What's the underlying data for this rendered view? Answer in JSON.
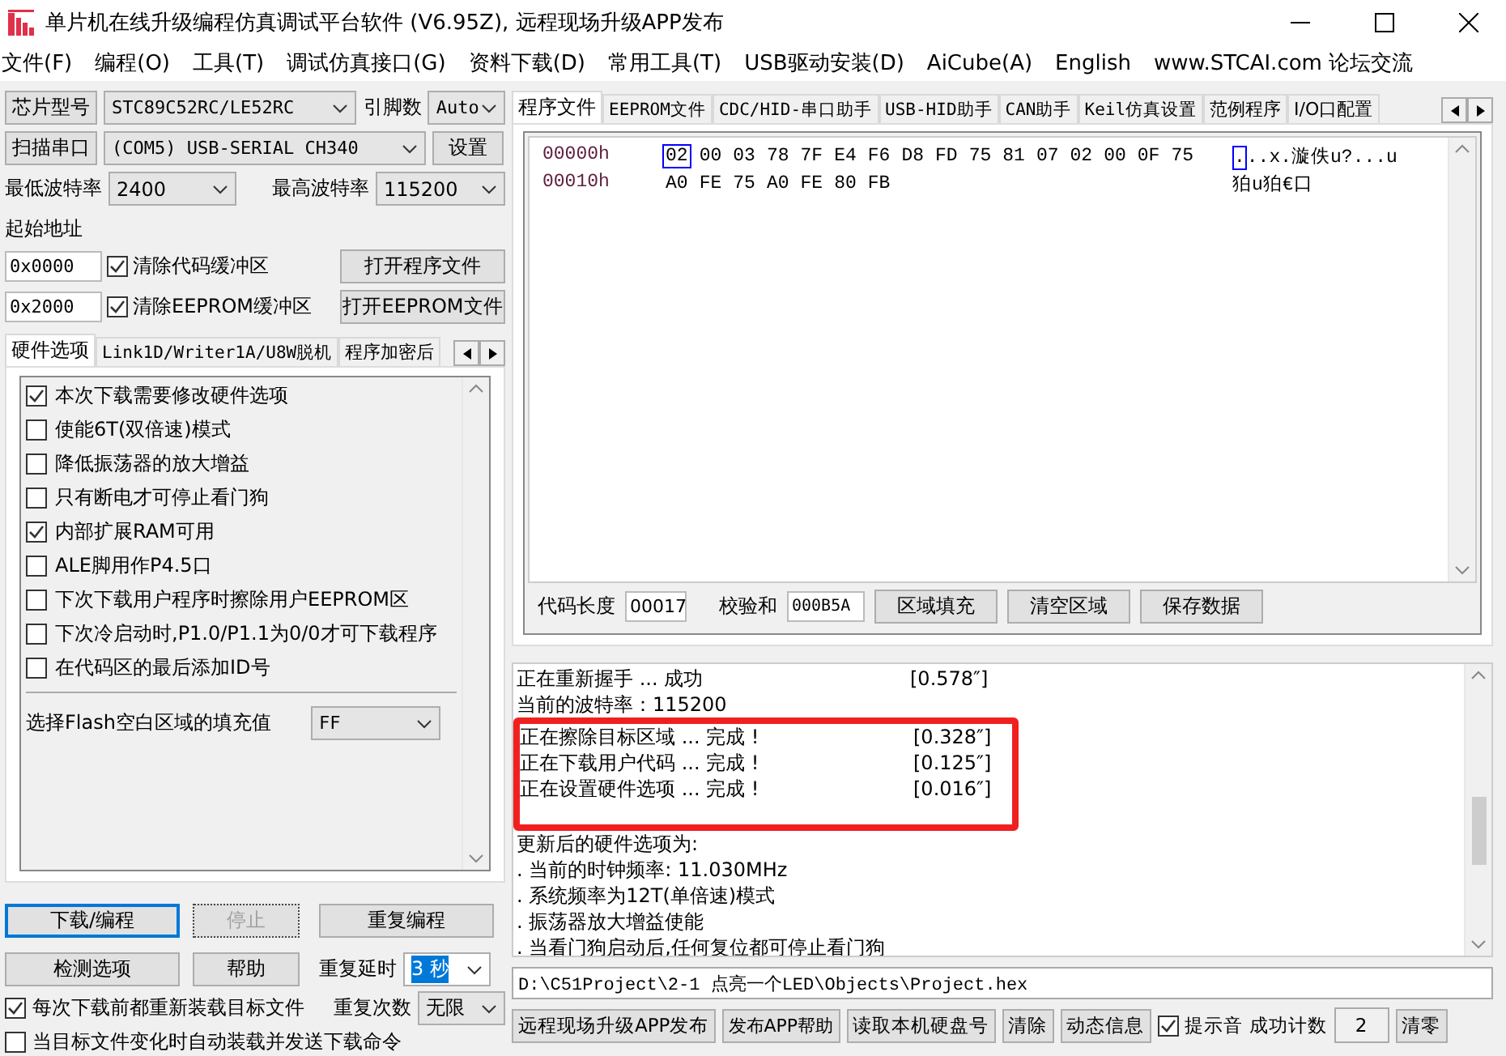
{
  "window": {
    "title": "单片机在线升级编程仿真调试平台软件 (V6.95Z), 远程现场升级APP发布"
  },
  "menu": [
    "文件(F)",
    "编程(O)",
    "工具(T)",
    "调试仿真接口(G)",
    "资料下载(D)",
    "常用工具(T)",
    "USB驱动安装(D)",
    "AiCube(A)",
    "English",
    "www.STCAI.com 论坛交流"
  ],
  "chip": {
    "button": "芯片型号",
    "model": "STC89C52RC/LE52RC",
    "pins_label": "引脚数",
    "pins": "Auto"
  },
  "port": {
    "button": "扫描串口",
    "value": "(COM5) USB-SERIAL CH340",
    "settings": "设置"
  },
  "baud": {
    "min_label": "最低波特率",
    "min": "2400",
    "max_label": "最高波特率",
    "max": "115200"
  },
  "start_address": {
    "label": "起始地址",
    "code_address": "0x0000",
    "clear_code": {
      "label": "清除代码缓冲区",
      "checked": true
    },
    "eeprom_address": "0x2000",
    "clear_eeprom": {
      "label": "清除EEPROM缓冲区",
      "checked": true
    },
    "open_program": "打开程序文件",
    "open_eeprom": "打开EEPROM文件"
  },
  "option_tabs": [
    {
      "label": "硬件选项",
      "selected": true
    },
    {
      "label": "Link1D/Writer1A/U8W脱机",
      "selected": false
    },
    {
      "label": "程序加密后",
      "selected": false
    }
  ],
  "hardware_options": [
    {
      "label": "本次下载需要修改硬件选项",
      "checked": true
    },
    {
      "label": "使能6T(双倍速)模式",
      "checked": false
    },
    {
      "label": "降低振荡器的放大增益",
      "checked": false
    },
    {
      "label": "只有断电才可停止看门狗",
      "checked": false
    },
    {
      "label": "内部扩展RAM可用",
      "checked": true
    },
    {
      "label": "ALE脚用作P4.5口",
      "checked": false
    },
    {
      "label": "下次下载用户程序时擦除用户EEPROM区",
      "checked": false
    },
    {
      "label": "下次冷启动时,P1.0/P1.1为0/0才可下载程序",
      "checked": false
    },
    {
      "label": "在代码区的最后添加ID号",
      "checked": false
    }
  ],
  "fill_value": {
    "label": "选择Flash空白区域的填充值",
    "value": "FF"
  },
  "actions": {
    "download": "下载/编程",
    "stop": {
      "label": "停止",
      "disabled": true
    },
    "repeat": "重复编程",
    "detect": "检测选项",
    "help": "帮助",
    "repeat_delay_label": "重复延时",
    "repeat_delay": "3 秒",
    "repeat_count_label": "重复次数",
    "repeat_count": "无限"
  },
  "reload": {
    "label": "每次下载前都重新装载目标文件",
    "checked": true
  },
  "auto_send": {
    "label": "当目标文件变化时自动装载并发送下载命令",
    "checked": false
  },
  "file_tabs": [
    {
      "label": "程序文件",
      "selected": true
    },
    {
      "label": "EEPROM文件",
      "selected": false
    },
    {
      "label": "CDC/HID-串口助手",
      "selected": false
    },
    {
      "label": "USB-HID助手",
      "selected": false
    },
    {
      "label": "CAN助手",
      "selected": false
    },
    {
      "label": "Keil仿真设置",
      "selected": false
    },
    {
      "label": "范例程序",
      "selected": false
    },
    {
      "label": "I/O口配置",
      "selected": false
    }
  ],
  "hex": {
    "rows": [
      {
        "address": "00000h",
        "bytes": [
          "02",
          "00",
          "03",
          "78",
          "7F",
          "E4",
          "F6",
          "D8",
          "FD",
          "75",
          "81",
          "07",
          "02",
          "00",
          "0F",
          "75"
        ],
        "ascii": "...x.漩佚u?...u",
        "cursor": true
      },
      {
        "address": "00010h",
        "bytes": [
          "A0",
          "FE",
          "75",
          "A0",
          "FE",
          "80",
          "FB"
        ],
        "ascii": "狛u狛€口",
        "cursor": false
      }
    ]
  },
  "code_length": {
    "label": "代码长度",
    "value": "00017"
  },
  "checksum": {
    "label": "校验和",
    "value": "000B5A"
  },
  "hex_buttons": [
    "区域填充",
    "清空区域",
    "保存数据"
  ],
  "log": {
    "lines": [
      {
        "text": "正在重新握手 ... 成功",
        "time": "[0.578″]",
        "highlighted": false
      },
      {
        "text": "当前的波特率：115200",
        "highlighted": false
      },
      {
        "text": "正在擦除目标区域 ... 完成 !",
        "time": "[0.328″]",
        "highlighted": true
      },
      {
        "text": "正在下载用户代码 ... 完成 !",
        "time": "[0.125″]",
        "highlighted": true
      },
      {
        "text": "正在设置硬件选项 ... 完成 !",
        "time": "[0.016″]",
        "highlighted": true
      },
      {
        "text": "更新后的硬件选项为:",
        "highlighted": false
      },
      {
        "text": ". 当前的时钟频率: 11.030MHz",
        "highlighted": false
      },
      {
        "text": ". 系统频率为12T(单倍速)模式",
        "highlighted": false
      },
      {
        "text": ". 振荡器放大增益使能",
        "highlighted": false
      },
      {
        "text": ". 当看门狗启动后,任何复位都可停止看门狗",
        "highlighted": false
      }
    ]
  },
  "file_path": "D:\\C51Project\\2-1 点亮一个LED\\Objects\\Project.hex",
  "bottom_buttons": [
    "远程现场升级APP发布",
    "发布APP帮助",
    "读取本机硬盘号",
    "清除",
    "动态信息"
  ],
  "beep": {
    "label": "提示音",
    "checked": true
  },
  "success_count": {
    "label": "成功计数",
    "value": "2"
  },
  "reset": "清零"
}
